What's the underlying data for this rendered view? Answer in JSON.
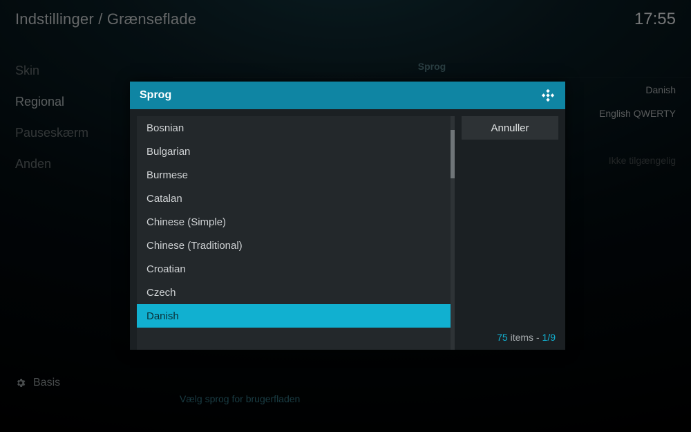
{
  "header": {
    "breadcrumb": "Indstillinger / Grænseflade",
    "clock": "17:55"
  },
  "sidebar": {
    "items": [
      {
        "label": "Skin"
      },
      {
        "label": "Regional"
      },
      {
        "label": "Pauseskærm"
      },
      {
        "label": "Anden"
      }
    ],
    "active_index": 1
  },
  "main": {
    "section_title": "Sprog",
    "rows": [
      {
        "value": "Danish"
      },
      {
        "value": "English QWERTY"
      },
      {
        "value": "Ikke tilgængelig",
        "disabled": true
      }
    ]
  },
  "footer": {
    "level_label": "Basis",
    "hint": "Vælg sprog for brugerfladen"
  },
  "dialog": {
    "title": "Sprog",
    "items": [
      "Bosnian",
      "Bulgarian",
      "Burmese",
      "Catalan",
      "Chinese (Simple)",
      "Chinese (Traditional)",
      "Croatian",
      "Czech",
      "Danish"
    ],
    "selected_index": 8,
    "cancel_label": "Annuller",
    "total_items": 75,
    "items_word": "items",
    "page_current": 1,
    "page_total": 9
  }
}
